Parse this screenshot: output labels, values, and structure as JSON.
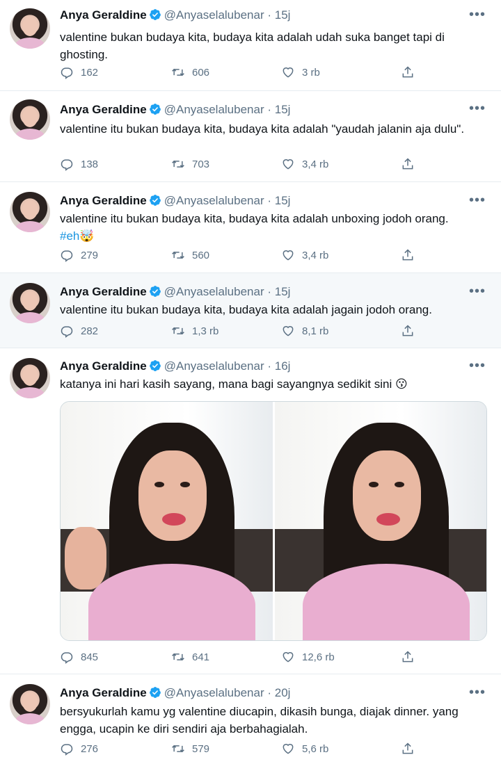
{
  "author": {
    "name": "Anya Geraldine",
    "handle": "@Anyaselalubenar"
  },
  "more_label": "•••",
  "colors": {
    "link": "#1b95e0",
    "muted": "#5b7083",
    "verified": "#1da1f2"
  },
  "tweets": [
    {
      "time": "· 15j",
      "text": "valentine bukan budaya kita, budaya kita adalah udah suka banget tapi di ghosting.",
      "replies": "162",
      "retweets": "606",
      "likes": "3 rb"
    },
    {
      "time": "· 15j",
      "text": "valentine itu bukan budaya kita, budaya kita adalah \"yaudah jalanin aja dulu\".",
      "replies": "138",
      "retweets": "703",
      "likes": "3,4 rb"
    },
    {
      "time": "· 15j",
      "text": "valentine itu bukan budaya kita, budaya kita adalah unboxing jodoh orang.",
      "hashtag": "#eh",
      "emoji": "🤯",
      "replies": "279",
      "retweets": "560",
      "likes": "3,4 rb"
    },
    {
      "time": "· 15j",
      "text": "valentine itu bukan budaya kita, budaya kita adalah jagain jodoh orang.",
      "replies": "282",
      "retweets": "1,3 rb",
      "likes": "8,1 rb"
    },
    {
      "time": "· 16j",
      "text": "katanya ini hari kasih sayang, mana bagi sayangnya sedikit sini",
      "emoji": "😗",
      "replies": "845",
      "retweets": "641",
      "likes": "12,6 rb"
    },
    {
      "time": "· 20j",
      "text": "bersyukurlah kamu yg valentine diucapin, dikasih bunga, diajak dinner. yang engga, ucapin ke diri sendiri aja berbahagialah.",
      "replies": "276",
      "retweets": "579",
      "likes": "5,6 rb"
    }
  ]
}
